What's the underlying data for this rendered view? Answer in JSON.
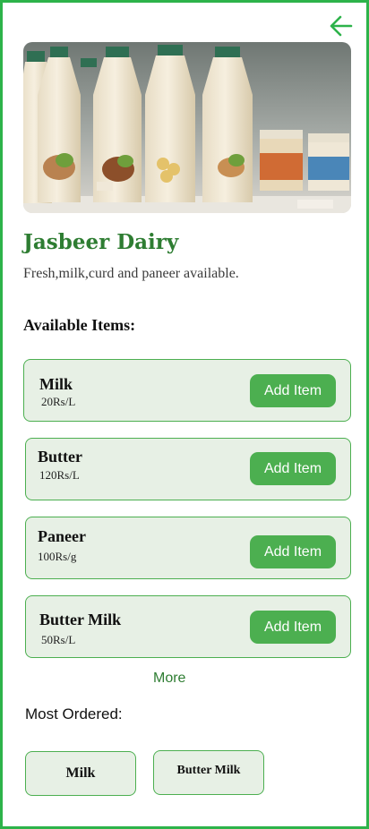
{
  "header": {
    "back_icon": "arrow-left-icon",
    "accent_color": "#2db34a"
  },
  "shop": {
    "name": "Jasbeer Dairy",
    "description": "Fresh,milk,curd and paneer available."
  },
  "available": {
    "title": "Available Items:",
    "items": [
      {
        "name": "Milk",
        "price": "20Rs/L",
        "button": "Add Item"
      },
      {
        "name": "Butter",
        "price": "120Rs/L",
        "button": "Add Item"
      },
      {
        "name": "Paneer",
        "price": "100Rs/g",
        "button": "Add Item"
      },
      {
        "name": "Butter Milk",
        "price": "50Rs/L",
        "button": "Add Item"
      }
    ],
    "more_label": "More"
  },
  "most_ordered": {
    "title": "Most Ordered:",
    "items": [
      "Milk",
      "Butter Milk"
    ]
  }
}
